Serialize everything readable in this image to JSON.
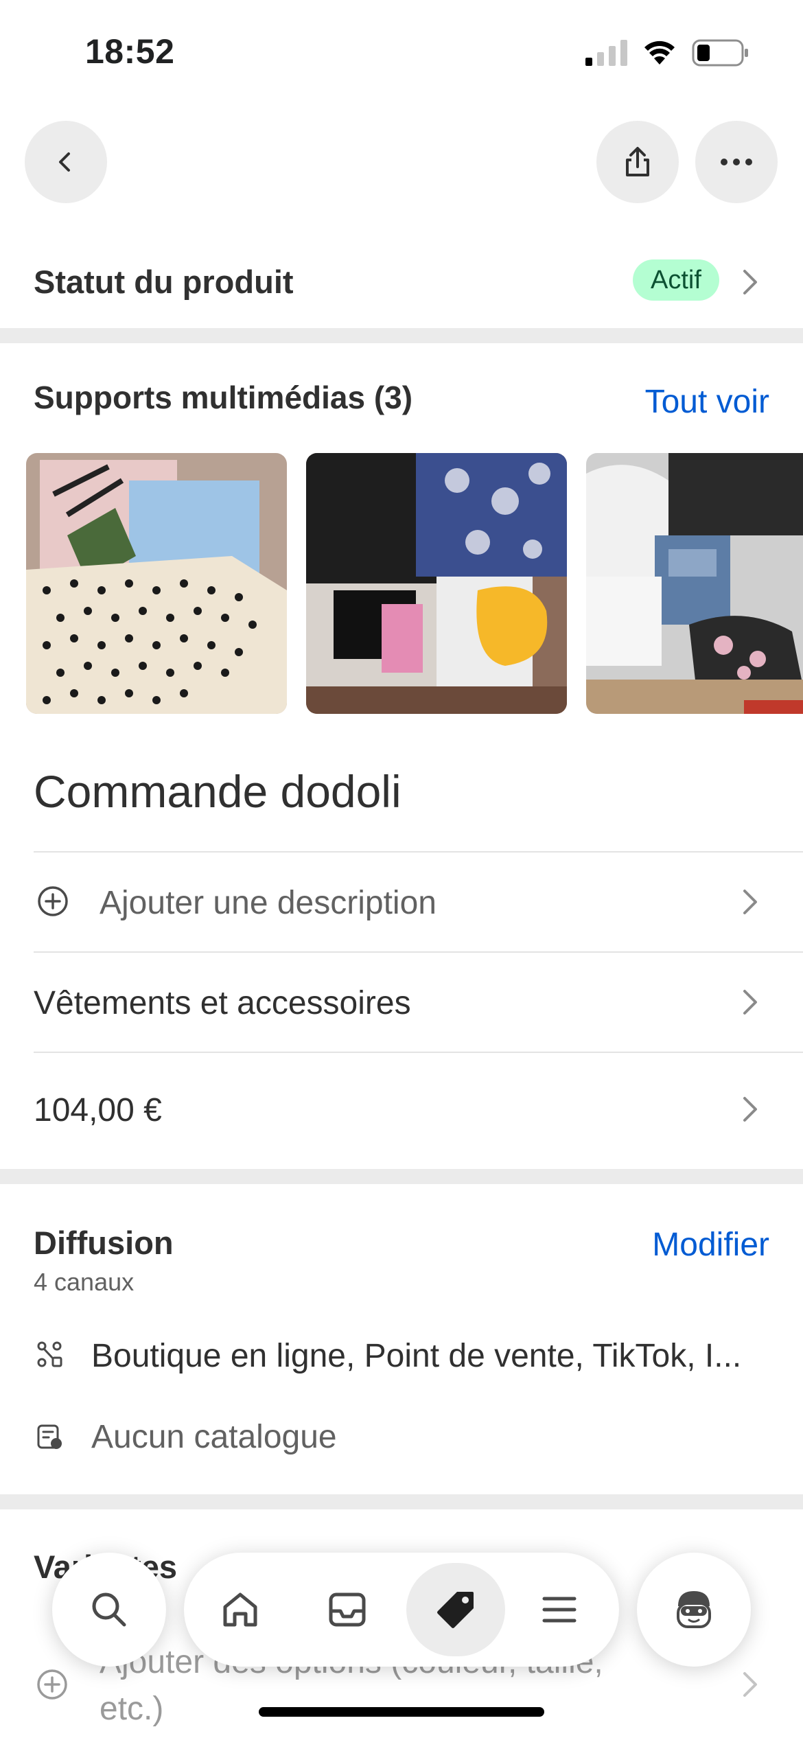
{
  "status_bar": {
    "time": "18:52"
  },
  "header": {
    "back_icon": "chevron-left-icon",
    "share_icon": "share-icon",
    "more_icon": "ellipsis-icon"
  },
  "product_status": {
    "label": "Statut du produit",
    "badge": "Actif",
    "badge_color": "#b4fed2"
  },
  "media": {
    "title": "Supports multimédias (3)",
    "see_all": "Tout voir",
    "images": [
      "product-photo-1",
      "product-photo-2",
      "product-photo-3"
    ]
  },
  "product": {
    "title": "Commande dodoli",
    "add_description": "Ajouter une description",
    "category": "Vêtements et accessoires",
    "price": "104,00 €"
  },
  "distribution": {
    "title": "Diffusion",
    "subtitle": "4 canaux",
    "edit": "Modifier",
    "channels": "Boutique en ligne, Point de vente, TikTok, I...",
    "catalog": "Aucun catalogue"
  },
  "variants": {
    "title": "Variantes",
    "add_options": "Ajouter des options (couleur, taille,",
    "add_options_2": "etc.)"
  },
  "bottom_nav": {
    "items": [
      "search-icon",
      "home-icon",
      "inbox-icon",
      "tag-icon",
      "menu-icon",
      "avatar-icon"
    ],
    "active": "tag-icon"
  },
  "colors": {
    "link": "#005bd3",
    "text": "#303030",
    "muted": "#616161"
  }
}
